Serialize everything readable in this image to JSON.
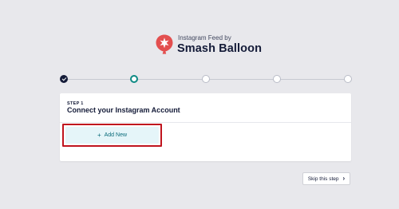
{
  "brand": {
    "subtitle": "Instagram Feed by",
    "title": "Smash Balloon",
    "logo_icon": "smash-balloon-logo-icon",
    "logo_color": "#e34f4f"
  },
  "stepper": {
    "steps": [
      {
        "state": "completed"
      },
      {
        "state": "active"
      },
      {
        "state": "upcoming"
      },
      {
        "state": "upcoming"
      },
      {
        "state": "upcoming"
      }
    ],
    "active_color": "#0e8a84"
  },
  "card": {
    "step_label": "STEP 1",
    "heading": "Connect your Instagram Account",
    "add_new_label": "Add New",
    "add_new_icon": "plus-icon"
  },
  "footer": {
    "skip_label": "Skip this step",
    "skip_icon": "chevron-right-icon"
  },
  "colors": {
    "background": "#e8e8ec",
    "highlight": "#c0141e",
    "button_bg": "#e5f5f9"
  }
}
